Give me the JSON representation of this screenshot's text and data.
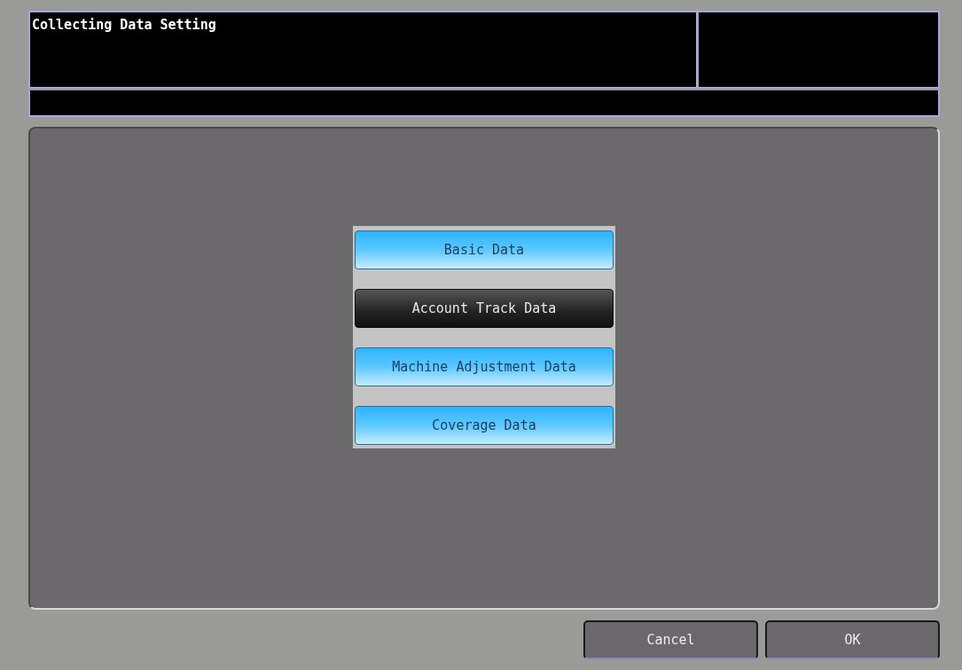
{
  "header": {
    "title": "Collecting Data Setting"
  },
  "options": [
    {
      "label": "Basic Data",
      "selected": false
    },
    {
      "label": "Account Track Data",
      "selected": true
    },
    {
      "label": "Machine Adjustment Data",
      "selected": false
    },
    {
      "label": "Coverage Data",
      "selected": false
    }
  ],
  "buttons": [
    "Cancel",
    "OK"
  ]
}
